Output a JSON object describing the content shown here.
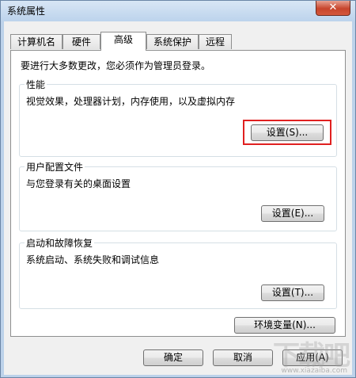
{
  "window": {
    "title": "系统属性",
    "close_label": "✕"
  },
  "tabs": [
    {
      "label": "计算机名",
      "active": false
    },
    {
      "label": "硬件",
      "active": false
    },
    {
      "label": "高级",
      "active": true
    },
    {
      "label": "系统保护",
      "active": false
    },
    {
      "label": "远程",
      "active": false
    }
  ],
  "intro_text": "要进行大多数更改，您必须作为管理员登录。",
  "groups": {
    "performance": {
      "title": "性能",
      "desc": "视觉效果，处理器计划，内存使用，以及虚拟内存",
      "button": "设置(S)..."
    },
    "user_profiles": {
      "title": "用户配置文件",
      "desc": "与您登录有关的桌面设置",
      "button": "设置(E)..."
    },
    "startup_recovery": {
      "title": "启动和故障恢复",
      "desc": "系统启动、系统失败和调试信息",
      "button": "设置(T)..."
    }
  },
  "env_button": "环境变量(N)...",
  "footer": {
    "ok": "确定",
    "cancel": "取消",
    "apply": "应用(A)"
  },
  "watermark": {
    "logo": "下载吧",
    "url": "www.xiazaiba.com"
  },
  "colors": {
    "highlight": "#e02020",
    "title_bar": "#bcd3ec",
    "close_button": "#c7452c"
  }
}
